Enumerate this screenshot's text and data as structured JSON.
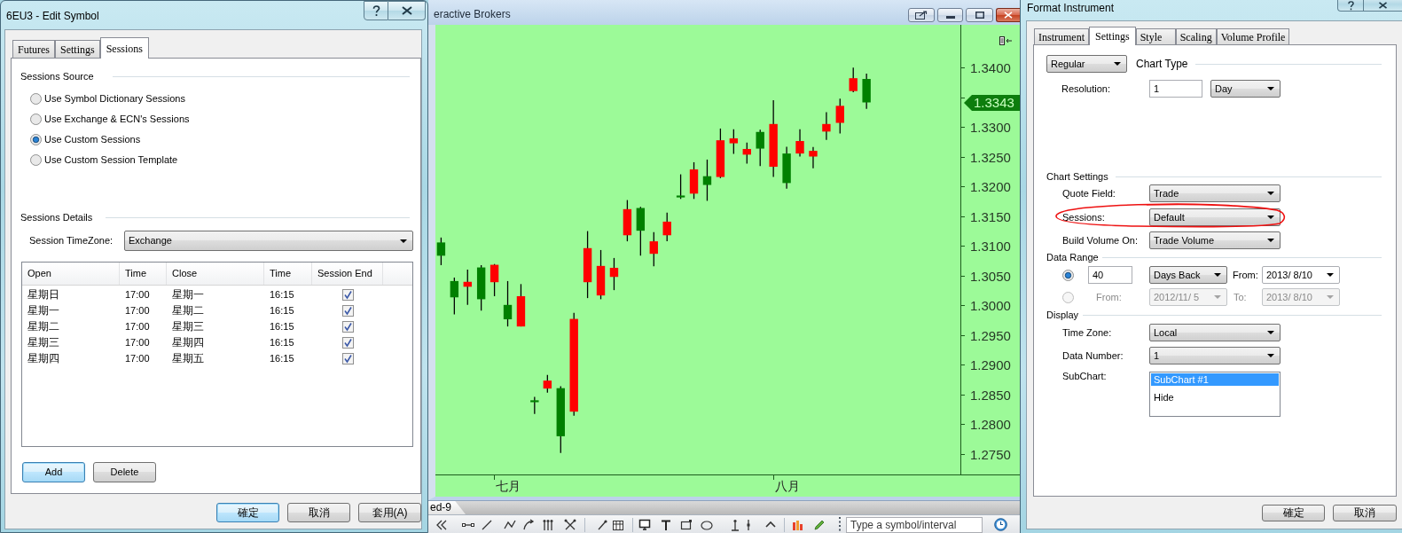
{
  "edit_symbol_dialog": {
    "title": "6EU3 - Edit Symbol",
    "tabs": [
      {
        "label": "Futures",
        "selected": false
      },
      {
        "label": "Settings",
        "selected": false
      },
      {
        "label": "Sessions",
        "selected": true
      }
    ],
    "sessions_source": {
      "heading": "Sessions Source",
      "options": [
        {
          "label": "Use Symbol Dictionary Sessions",
          "selected": false
        },
        {
          "label": "Use Exchange & ECN's Sessions",
          "selected": false
        },
        {
          "label": "Use Custom Sessions",
          "selected": true
        },
        {
          "label": "Use Custom Session Template",
          "selected": false
        }
      ]
    },
    "sessions_details": {
      "heading": "Sessions Details",
      "timezone_label": "Session TimeZone:",
      "timezone_value": "Exchange"
    },
    "sessions_table": {
      "columns": [
        "Open",
        "Time",
        "Close",
        "Time",
        "Session End"
      ],
      "rows": [
        {
          "open_day": "星期日",
          "open_time": "17:00",
          "close_day": "星期一",
          "close_time": "16:15",
          "session_end": true
        },
        {
          "open_day": "星期一",
          "open_time": "17:00",
          "close_day": "星期二",
          "close_time": "16:15",
          "session_end": true
        },
        {
          "open_day": "星期二",
          "open_time": "17:00",
          "close_day": "星期三",
          "close_time": "16:15",
          "session_end": true
        },
        {
          "open_day": "星期三",
          "open_time": "17:00",
          "close_day": "星期四",
          "close_time": "16:15",
          "session_end": true
        },
        {
          "open_day": "星期四",
          "open_time": "17:00",
          "close_day": "星期五",
          "close_time": "16:15",
          "session_end": true
        }
      ]
    },
    "table_buttons": [
      {
        "label": "Add",
        "default": true
      },
      {
        "label": "Delete",
        "default": false
      }
    ],
    "footer_buttons": [
      {
        "label": "確定",
        "default": true
      },
      {
        "label": "取消",
        "default": false
      },
      {
        "label": "套用(A)",
        "default": false
      }
    ]
  },
  "chart_window": {
    "title": "eractive Brokers",
    "price_axis": {
      "labels": [
        "1.3400",
        "1.3300",
        "1.3250",
        "1.3200",
        "1.3150",
        "1.3100",
        "1.3050",
        "1.3000",
        "1.2950",
        "1.2900",
        "1.2850",
        "1.2800",
        "1.2750"
      ],
      "current_price": "1.3343"
    },
    "time_axis": {
      "labels": [
        "七月",
        "八月"
      ]
    },
    "tabs": [
      {
        "label": "ed-9",
        "selected": true
      }
    ],
    "symbol_field": {
      "placeholder": "Type a symbol/interval"
    }
  },
  "format_instrument_dialog": {
    "title": "Format Instrument",
    "tabs": [
      {
        "label": "Instrument",
        "selected": false
      },
      {
        "label": "Settings",
        "selected": true
      },
      {
        "label": "Style",
        "selected": false
      },
      {
        "label": "Scaling",
        "selected": false
      },
      {
        "label": "Volume Profile",
        "selected": false
      }
    ],
    "chart_type": {
      "value": "Regular",
      "label": "Chart Type"
    },
    "resolution": {
      "label": "Resolution:",
      "value": "1",
      "unit": "Day"
    },
    "chart_settings": {
      "heading": "Chart Settings",
      "fields": [
        {
          "label": "Quote Field:",
          "value": "Trade",
          "circled": false
        },
        {
          "label": "Sessions:",
          "value": "Default",
          "circled": true
        },
        {
          "label": "Build Volume On:",
          "value": "Trade Volume",
          "circled": false
        }
      ]
    },
    "data_range": {
      "heading": "Data Range",
      "rows": [
        {
          "kind": "days_back",
          "selected": true,
          "disabled": false,
          "count": "40",
          "unit": "Days Back",
          "date_label": "From:",
          "date": "2013/ 8/10"
        },
        {
          "kind": "date_range",
          "selected": false,
          "disabled": true,
          "from_label": "From:",
          "from_date": "2012/11/ 5",
          "to_label": "To:",
          "to_date": "2013/ 8/10"
        }
      ]
    },
    "display": {
      "heading": "Display",
      "fields": [
        {
          "label": "Time Zone:",
          "value": "Local"
        },
        {
          "label": "Data Number:",
          "value": "1"
        }
      ],
      "subchart": {
        "label": "SubChart:",
        "options": [
          {
            "label": "SubChart #1",
            "selected": true
          },
          {
            "label": "Hide",
            "selected": false
          }
        ]
      }
    },
    "footer_buttons": [
      {
        "label": "確定",
        "default": false
      },
      {
        "label": "取消",
        "default": false
      }
    ]
  }
}
